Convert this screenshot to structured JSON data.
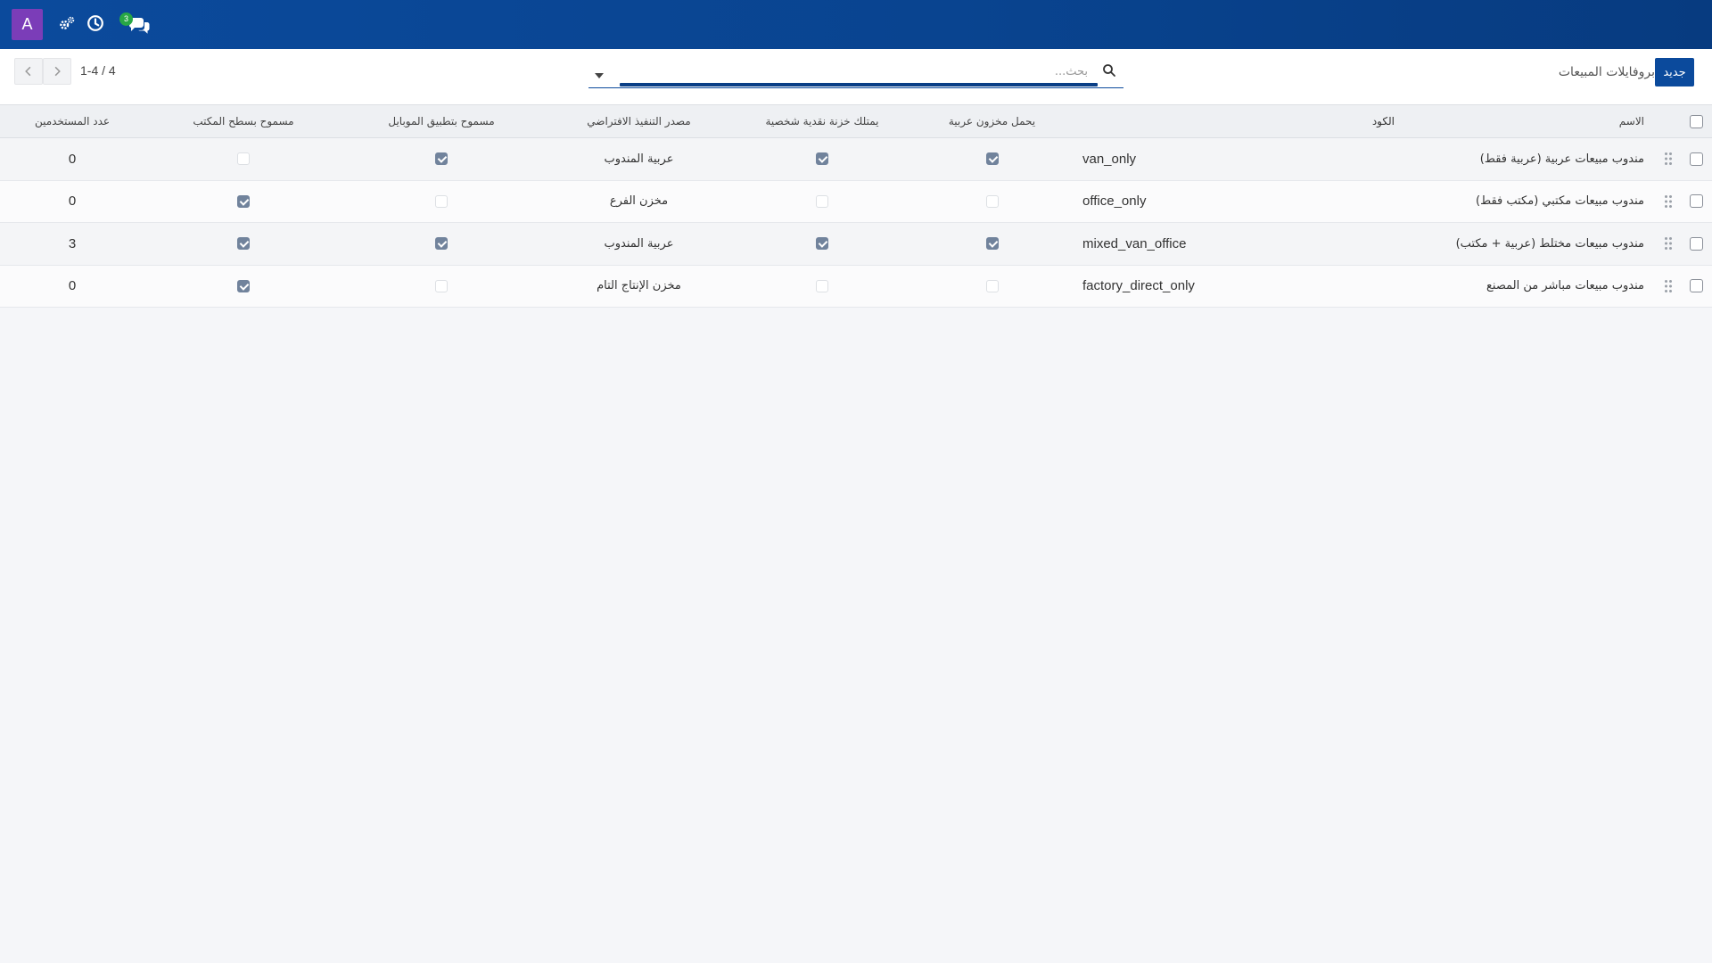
{
  "topbar": {
    "avatar_letter": "A",
    "chat_badge": "3",
    "icons": [
      "settings-gears-icon",
      "history-clock-icon",
      "chat-icon"
    ],
    "bg_color": "#0b4a9c"
  },
  "control": {
    "new_button": "جديد",
    "breadcrumb": "بروفايلات المبيعات",
    "search_placeholder": "بحث...",
    "pager_text": "1-4 / 4"
  },
  "table": {
    "columns": {
      "name": "الاسم",
      "code": "الكود",
      "van_stock": "يحمل مخزون عربية",
      "cash_box": "يمتلك خزنة نقدية شخصية",
      "source": "مصدر التنفيذ الافتراضي",
      "mobile": "مسموح بتطبيق الموبايل",
      "desktop": "مسموح بسطح المكتب",
      "users": "عدد المستخدمين"
    },
    "rows": [
      {
        "name": "مندوب مبيعات عربية (عربية فقط)",
        "code": "van_only",
        "van_stock": true,
        "cash_box": true,
        "source": "عربية المندوب",
        "mobile": true,
        "desktop": false,
        "users": "0"
      },
      {
        "name": "مندوب مبيعات مكتبي (مكتب فقط)",
        "code": "office_only",
        "van_stock": false,
        "cash_box": false,
        "source": "مخزن الفرع",
        "mobile": false,
        "desktop": true,
        "users": "0"
      },
      {
        "name": "مندوب مبيعات مختلط (عربية + مكتب)",
        "code": "mixed_van_office",
        "van_stock": true,
        "cash_box": true,
        "source": "عربية المندوب",
        "mobile": true,
        "desktop": true,
        "users": "3"
      },
      {
        "name": "مندوب مبيعات مباشر من المصنع",
        "code": "factory_direct_only",
        "van_stock": false,
        "cash_box": false,
        "source": "مخزن الإنتاج التام",
        "mobile": false,
        "desktop": true,
        "users": "0"
      }
    ],
    "check_color": "#71839c"
  }
}
